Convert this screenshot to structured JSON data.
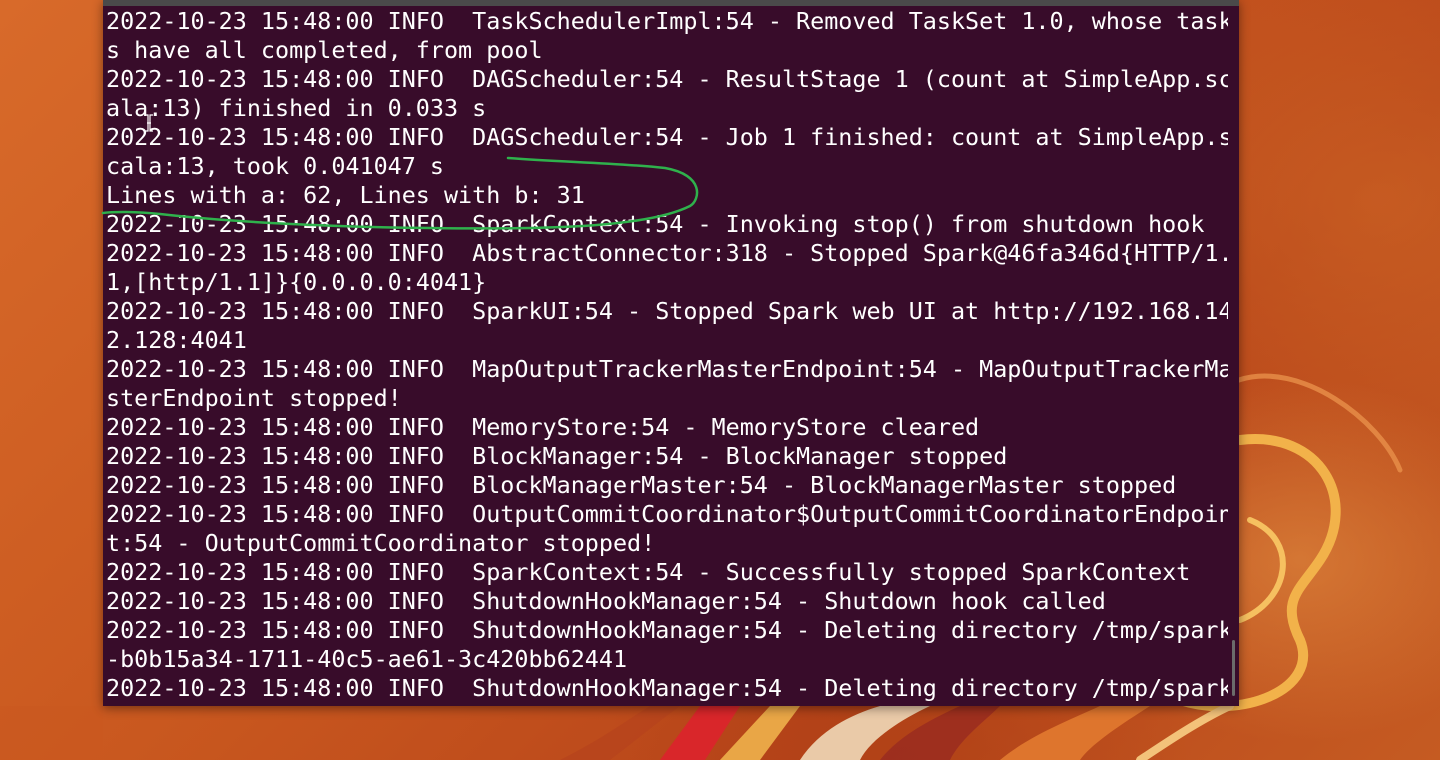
{
  "colors": {
    "terminal_bg": "#380c2a",
    "terminal_text": "#ffffff",
    "annotation_stroke": "#2fb14c",
    "desktop_bg": "#c4561c"
  },
  "icons": {
    "cursor": "text-cursor-icon"
  },
  "terminal": {
    "lines": [
      "2022-10-23 15:48:00 INFO  TaskSchedulerImpl:54 - Removed TaskSet 1.0, whose task",
      "s have all completed, from pool",
      "2022-10-23 15:48:00 INFO  DAGScheduler:54 - ResultStage 1 (count at SimpleApp.sc",
      "ala:13) finished in 0.033 s",
      "2022-10-23 15:48:00 INFO  DAGScheduler:54 - Job 1 finished: count at SimpleApp.s",
      "cala:13, took 0.041047 s",
      "Lines with a: 62, Lines with b: 31",
      "2022-10-23 15:48:00 INFO  SparkContext:54 - Invoking stop() from shutdown hook",
      "2022-10-23 15:48:00 INFO  AbstractConnector:318 - Stopped Spark@46fa346d{HTTP/1.",
      "1,[http/1.1]}{0.0.0.0:4041}",
      "2022-10-23 15:48:00 INFO  SparkUI:54 - Stopped Spark web UI at http://192.168.14",
      "2.128:4041",
      "2022-10-23 15:48:00 INFO  MapOutputTrackerMasterEndpoint:54 - MapOutputTrackerMa",
      "sterEndpoint stopped!",
      "2022-10-23 15:48:00 INFO  MemoryStore:54 - MemoryStore cleared",
      "2022-10-23 15:48:00 INFO  BlockManager:54 - BlockManager stopped",
      "2022-10-23 15:48:00 INFO  BlockManagerMaster:54 - BlockManagerMaster stopped",
      "2022-10-23 15:48:00 INFO  OutputCommitCoordinator$OutputCommitCoordinatorEndpoin",
      "t:54 - OutputCommitCoordinator stopped!",
      "2022-10-23 15:48:00 INFO  SparkContext:54 - Successfully stopped SparkContext",
      "2022-10-23 15:48:00 INFO  ShutdownHookManager:54 - Shutdown hook called",
      "2022-10-23 15:48:00 INFO  ShutdownHookManager:54 - Deleting directory /tmp/spark",
      "-b0b15a34-1711-40c5-ae61-3c420bb62441",
      "2022-10-23 15:48:00 INFO  ShutdownHookManager:54 - Deleting directory /tmp/spark"
    ]
  }
}
